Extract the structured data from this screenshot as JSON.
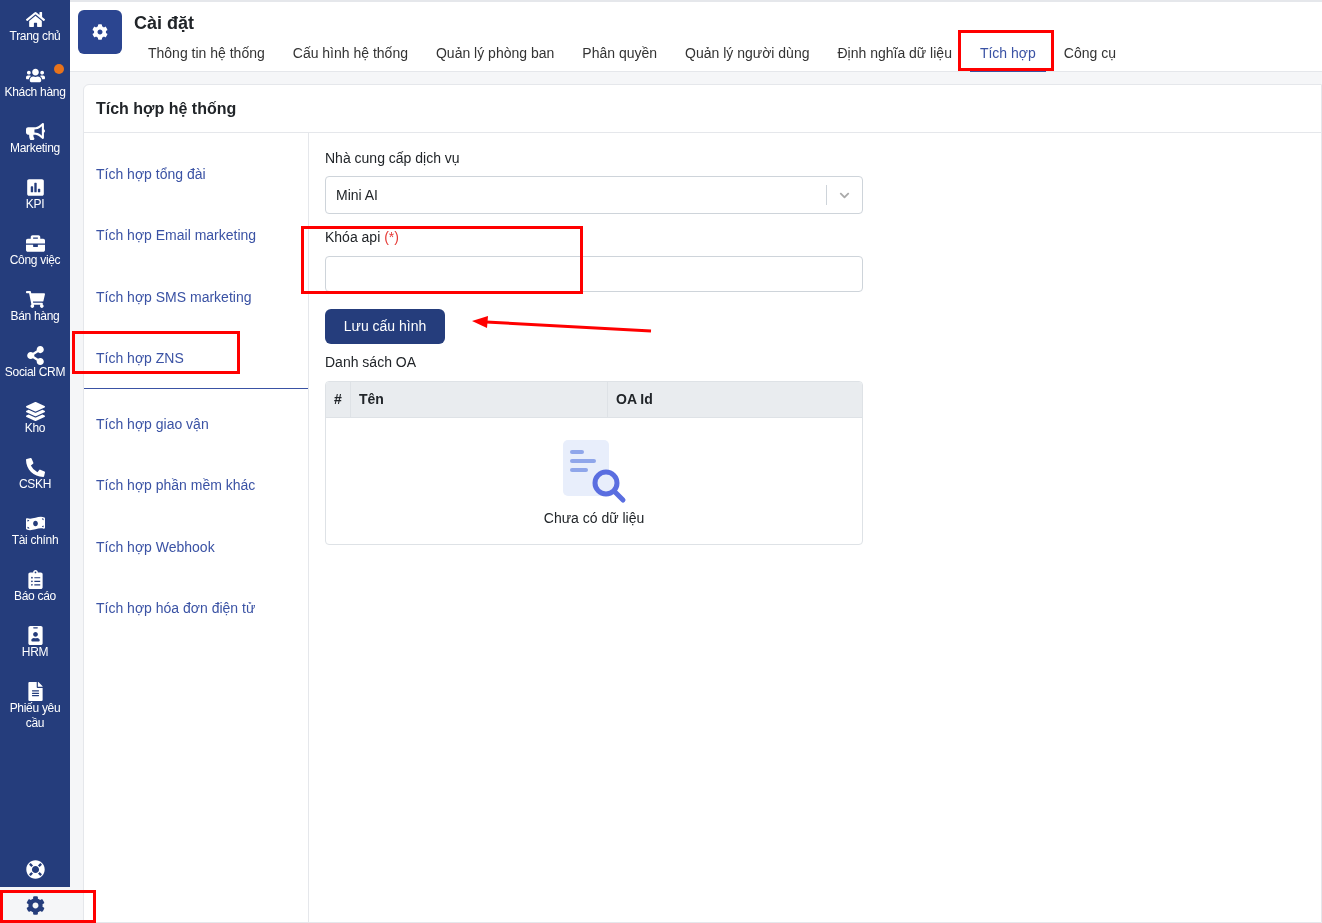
{
  "sidebar": {
    "items": [
      {
        "label": "Trang chủ",
        "dot": false,
        "selected": false
      },
      {
        "label": "Khách hàng",
        "dot": true,
        "selected": false
      },
      {
        "label": "Marketing",
        "dot": false,
        "selected": false
      },
      {
        "label": "KPI",
        "dot": false,
        "selected": false
      },
      {
        "label": "Công việc",
        "dot": false,
        "selected": false
      },
      {
        "label": "Bán hàng",
        "dot": false,
        "selected": false
      },
      {
        "label": "Social CRM",
        "dot": false,
        "selected": false
      },
      {
        "label": "Kho",
        "dot": false,
        "selected": false
      },
      {
        "label": "CSKH",
        "dot": false,
        "selected": false
      },
      {
        "label": "Tài chính",
        "dot": false,
        "selected": false
      },
      {
        "label": "Báo cáo",
        "dot": false,
        "selected": false
      },
      {
        "label": "HRM",
        "dot": false,
        "selected": false
      },
      {
        "label": "Phiếu yêu cầu",
        "dot": false,
        "selected": false
      }
    ],
    "bottom_items": [
      {
        "kind": "help",
        "selected": false
      },
      {
        "kind": "settings",
        "selected": true
      }
    ]
  },
  "header": {
    "title": "Cài đặt",
    "tabs": [
      {
        "label": "Thông tin hệ thống",
        "selected": false
      },
      {
        "label": "Cấu hình hệ thống",
        "selected": false
      },
      {
        "label": "Quản lý phòng ban",
        "selected": false
      },
      {
        "label": "Phân quyền",
        "selected": false
      },
      {
        "label": "Quản lý người dùng",
        "selected": false
      },
      {
        "label": "Định nghĩa dữ liệu",
        "selected": false
      },
      {
        "label": "Tích hợp",
        "selected": true
      },
      {
        "label": "Công cụ",
        "selected": false
      }
    ]
  },
  "card": {
    "title": "Tích hợp hệ thống",
    "menu": [
      {
        "label": "Tích hợp tổng đài",
        "selected": false
      },
      {
        "label": "Tích hợp Email marketing",
        "selected": false
      },
      {
        "label": "Tích hợp SMS marketing",
        "selected": false
      },
      {
        "label": "Tích hợp ZNS",
        "selected": true
      },
      {
        "label": "Tích hợp giao vận",
        "selected": false
      },
      {
        "label": "Tích hợp phần mềm khác",
        "selected": false
      },
      {
        "label": "Tích hợp Webhook",
        "selected": false
      },
      {
        "label": "Tích hợp hóa đơn điện tử",
        "selected": false
      }
    ],
    "form": {
      "provider_label": "Nhà cung cấp dịch vụ",
      "provider_value": "Mini AI",
      "api_key_label": "Khóa api",
      "required_mark": "(*)",
      "save_button": "Lưu cấu hình",
      "oa_list_title": "Danh sách OA",
      "table": {
        "columns": [
          "#",
          "Tên",
          "OA Id"
        ],
        "empty_text": "Chưa có dữ liệu"
      }
    }
  }
}
